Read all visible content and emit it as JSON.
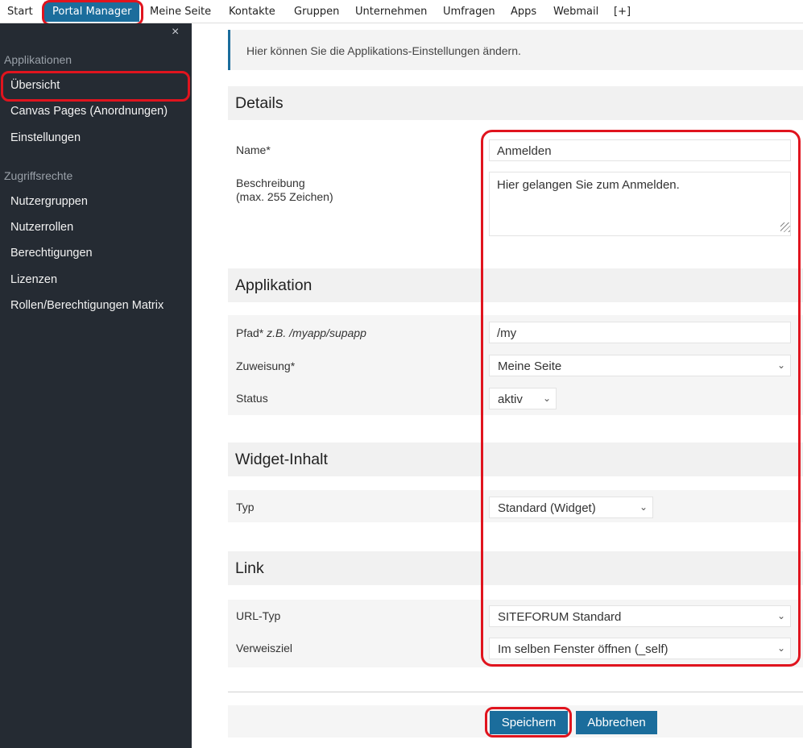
{
  "topnav": {
    "items": [
      "Start",
      "Portal Manager",
      "Meine Seite",
      "Kontakte",
      "Gruppen",
      "Unternehmen",
      "Umfragen",
      "Apps",
      "Webmail",
      "[+]"
    ]
  },
  "sidebar": {
    "close": "×",
    "section1": "Applikationen",
    "items1": [
      "Übersicht",
      "Canvas Pages (Anordnungen)",
      "Einstellungen"
    ],
    "section2": "Zugriffsrechte",
    "items2": [
      "Nutzergruppen",
      "Nutzerrollen",
      "Berechtigungen",
      "Lizenzen",
      "Rollen/Berechtigungen Matrix"
    ]
  },
  "main": {
    "info": "Hier können Sie die Applikations-Einstellungen ändern.",
    "details": {
      "title": "Details",
      "name_label": "Name*",
      "name_value": "Anmelden",
      "desc_label_1": "Beschreibung",
      "desc_label_2": "(max. 255 Zeichen)",
      "desc_value": "Hier gelangen Sie zum Anmelden."
    },
    "application": {
      "title": "Applikation",
      "path_label": "Pfad*",
      "path_hint": "z.B. /myapp/supapp",
      "path_value": "/my",
      "assign_label": "Zuweisung*",
      "assign_value": "Meine Seite",
      "status_label": "Status",
      "status_value": "aktiv"
    },
    "widget": {
      "title": "Widget-Inhalt",
      "type_label": "Typ",
      "type_value": "Standard (Widget)"
    },
    "link": {
      "title": "Link",
      "urltype_label": "URL-Typ",
      "urltype_value": "SITEFORUM Standard",
      "target_label": "Verweisziel",
      "target_value": "Im selben Fenster öffnen (_self)"
    },
    "buttons": {
      "save": "Speichern",
      "cancel": "Abbrechen"
    }
  },
  "icons": {
    "chevron": "chevron-down-icon",
    "close": "close-icon"
  },
  "colors": {
    "accent": "#1b6d9c",
    "sidebar_bg": "#252b33",
    "annotation": "#e0141e"
  }
}
